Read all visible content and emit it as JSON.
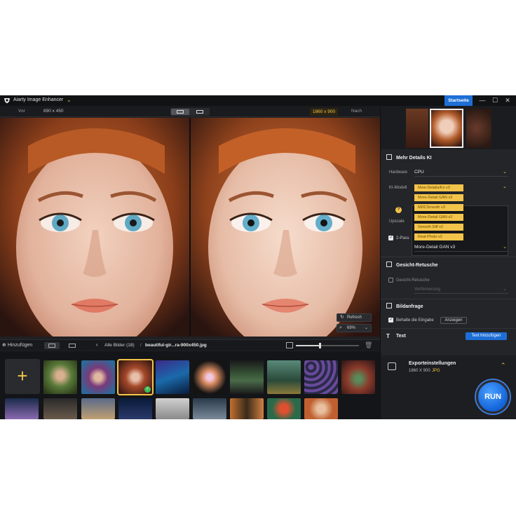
{
  "app": {
    "title": "Aiarty Image Enhancer",
    "startpage_label": "Startseite"
  },
  "window_controls": {
    "minimize": "—",
    "maximize": "☐",
    "close": "✕"
  },
  "compare": {
    "before_label": "Vor",
    "before_size": "890 x 450",
    "after_size": "1860 x 900",
    "after_label": "Nach"
  },
  "preview": {
    "refresh_label": "Refresh",
    "zoom_value": "69%"
  },
  "gallery": {
    "add_label": "Hinzufügen",
    "all_images_label": "Alle Bilder (18)",
    "path_separator": "/",
    "current_file": "beautiful-gir...ra-900x450.jpg",
    "size_slider_value": 0.38
  },
  "panel": {
    "section_more_details": "Mehr Details KI",
    "hardware_label": "Hardware",
    "hardware_value": "CPU",
    "model_label": "KI-Modell",
    "models": [
      "Mew-Details/Ko v3",
      "More-Detail GAN v3",
      "MDCSmooth v3",
      "More-Detail GAN v2",
      "Smooth Diff v2",
      "Real-Photo v2"
    ],
    "upscale_label": "Upscale",
    "two_pass_label": "2-Pass",
    "second_model_value": "More-Detail GAN v3",
    "section_face": "Gesicht-Retusche",
    "face_retouch_label": "Gesicht-Retusche",
    "face_dropdown_placeholder": "Verfeinerung",
    "section_background": "Bildanfrage",
    "keep_input_label": "Behalte die Eingabe",
    "show_button": "Anzeigen",
    "section_text": "Text",
    "add_text_button": "Text hinzufügen",
    "export_title": "Exporteinstellungen",
    "export_size": "1860 X 900",
    "export_format": "JPG",
    "run_label": "RUN"
  },
  "colors": {
    "accent": "#f3c44a",
    "primary": "#1d6fd6",
    "background": "#1f2023"
  }
}
